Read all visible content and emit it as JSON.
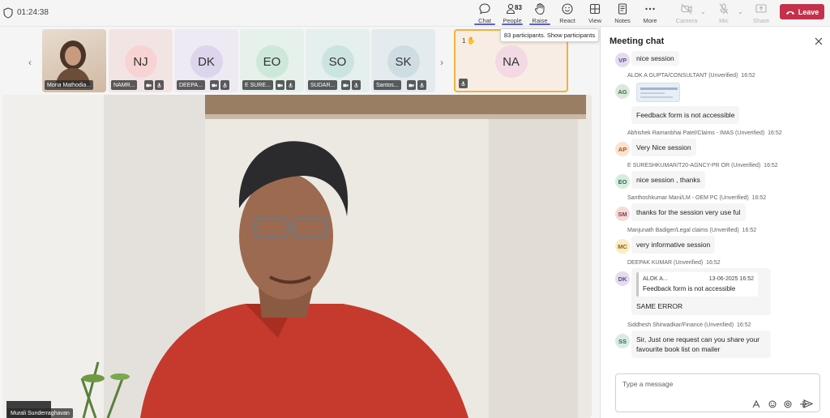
{
  "header": {
    "timer": "01:24:38",
    "buttons": {
      "chat": "Chat",
      "people": "People",
      "people_count": "83",
      "raise": "Raise",
      "react": "React",
      "view": "View",
      "notes": "Notes",
      "more": "More",
      "camera": "Camera",
      "mic": "Mic",
      "share": "Share"
    },
    "leave": "Leave"
  },
  "tooltip": "83 participants. Show participants",
  "strip": {
    "tiles": [
      {
        "initials": "",
        "name": "Mona Mathodia...",
        "bg": "#d9c7b8",
        "video": true
      },
      {
        "initials": "NJ",
        "name": "NAMR...",
        "bg": "#f3e4e4",
        "av": "#f7d3d3"
      },
      {
        "initials": "DK",
        "name": "DEEPA...",
        "bg": "#eeeaf3",
        "av": "#dcd5ec"
      },
      {
        "initials": "EO",
        "name": "E SURE...",
        "bg": "#e5f1ea",
        "av": "#cde7d8"
      },
      {
        "initials": "SO",
        "name": "SUDAR...",
        "bg": "#e4efee",
        "av": "#cbe4e1"
      },
      {
        "initials": "SK",
        "name": "Santos...",
        "bg": "#e3ebee",
        "av": "#cfdde2"
      }
    ],
    "featured": {
      "initials": "NA",
      "raise_count": "1",
      "bg": "#f7ede4",
      "av": "#f2d9e3"
    }
  },
  "main_video": {
    "speaker": "Murali Sunderraghavan"
  },
  "chat": {
    "title": "Meeting chat",
    "messages": [
      {
        "initials": "VP",
        "text": "nice session",
        "av_bg": "#e3dcef",
        "av_fg": "#5c4b8a"
      },
      {
        "author": "ALOK A GUPTA/CONSULTANT (Unverified)",
        "time": "16:52",
        "initials": "AG",
        "text": "Feedback form is not accessible",
        "av_bg": "#dce8df",
        "av_fg": "#3d6b49"
      },
      {
        "author": "Abhishek Ramanbhai Patel/Claims - IMAS (Unverified)",
        "time": "16:52",
        "initials": "AP",
        "text": "Very Nice session",
        "av_bg": "#fbe3cf",
        "av_fg": "#a0541b"
      },
      {
        "author": "E SURESHKUMAR/T20-AGNCY-PR OR (Unverified)",
        "time": "16:52",
        "initials": "EO",
        "text": "nice session , thanks",
        "av_bg": "#d6ece0",
        "av_fg": "#2f6a47"
      },
      {
        "author": "Santhoshkumar Mani/LM - OEM PC (Unverified)",
        "time": "16:52",
        "initials": "SM",
        "text": "thanks for the session very use ful",
        "av_bg": "#f1dcdc",
        "av_fg": "#8a3c3c"
      },
      {
        "author": "Manjunath Badiger/Legal claims (Unverified)",
        "time": "16:52",
        "initials": "MC",
        "text": "very informative session",
        "av_bg": "#fcebc4",
        "av_fg": "#8d6412"
      },
      {
        "author": "DEEPAK KUMAR (Unverified)",
        "time": "16:52",
        "initials": "DK",
        "quote_author": "ALOK A...",
        "quote_time": "13-06-2025 16:52",
        "quote_text": "Feedback form is not accessible",
        "text": "SAME ERROR",
        "av_bg": "#e3dcef",
        "av_fg": "#5c4b8a"
      },
      {
        "author": "Siddhesh Shirwadkar/Finance (Unverified)",
        "time": "16:52",
        "initials": "SS",
        "text_line1": "Sir, Just one request can you share your",
        "text_line2": "favourite book list on mailer",
        "av_bg": "#d6ece3",
        "av_fg": "#2f6a55"
      }
    ],
    "compose_placeholder": "Type a message"
  }
}
